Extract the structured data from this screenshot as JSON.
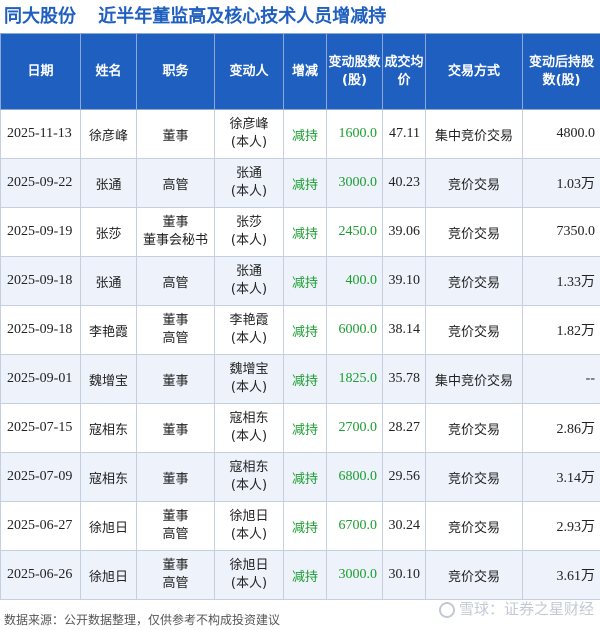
{
  "title": {
    "company": "同大股份",
    "subject": "近半年董监高及核心技术人员增减持"
  },
  "columns": [
    "日期",
    "姓名",
    "职务",
    "变动人",
    "增减",
    "变动股数(股)",
    "成交均价",
    "交易方式",
    "变动后持股数(股)"
  ],
  "header_lines": {
    "date": "日期",
    "name": "姓名",
    "role": "职务",
    "actor": "变动人",
    "dir": "增减",
    "shares_1": "变动股数",
    "shares_2": "(股)",
    "price_1": "成交",
    "price_2": "均价",
    "method": "交易方式",
    "after_1": "变动后",
    "after_2": "持股数",
    "after_3": "(股)"
  },
  "rows": [
    {
      "date": "2025-11-13",
      "name": "徐彦峰",
      "role1": "董事",
      "role2": "",
      "actor1": "徐彦峰",
      "actor2": "(本人)",
      "dir": "减持",
      "shares": "1600.0",
      "price": "47.11",
      "method": "集中竞价交易",
      "after": "4800.0"
    },
    {
      "date": "2025-09-22",
      "name": "张通",
      "role1": "高管",
      "role2": "",
      "actor1": "张通",
      "actor2": "(本人)",
      "dir": "减持",
      "shares": "3000.0",
      "price": "40.23",
      "method": "竞价交易",
      "after": "1.03万"
    },
    {
      "date": "2025-09-19",
      "name": "张莎",
      "role1": "董事",
      "role2": "董事会秘书",
      "actor1": "张莎",
      "actor2": "(本人)",
      "dir": "减持",
      "shares": "2450.0",
      "price": "39.06",
      "method": "竞价交易",
      "after": "7350.0"
    },
    {
      "date": "2025-09-18",
      "name": "张通",
      "role1": "高管",
      "role2": "",
      "actor1": "张通",
      "actor2": "(本人)",
      "dir": "减持",
      "shares": "400.0",
      "price": "39.10",
      "method": "竞价交易",
      "after": "1.33万"
    },
    {
      "date": "2025-09-18",
      "name": "李艳霞",
      "role1": "董事",
      "role2": "高管",
      "actor1": "李艳霞",
      "actor2": "(本人)",
      "dir": "减持",
      "shares": "6000.0",
      "price": "38.14",
      "method": "竞价交易",
      "after": "1.82万"
    },
    {
      "date": "2025-09-01",
      "name": "魏增宝",
      "role1": "董事",
      "role2": "",
      "actor1": "魏增宝",
      "actor2": "(本人)",
      "dir": "减持",
      "shares": "1825.0",
      "price": "35.78",
      "method": "集中竞价交易",
      "after": "--"
    },
    {
      "date": "2025-07-15",
      "name": "寇相东",
      "role1": "董事",
      "role2": "",
      "actor1": "寇相东",
      "actor2": "(本人)",
      "dir": "减持",
      "shares": "2700.0",
      "price": "28.27",
      "method": "竞价交易",
      "after": "2.86万"
    },
    {
      "date": "2025-07-09",
      "name": "寇相东",
      "role1": "董事",
      "role2": "",
      "actor1": "寇相东",
      "actor2": "(本人)",
      "dir": "减持",
      "shares": "6800.0",
      "price": "29.56",
      "method": "竞价交易",
      "after": "3.14万"
    },
    {
      "date": "2025-06-27",
      "name": "徐旭日",
      "role1": "董事",
      "role2": "高管",
      "actor1": "徐旭日",
      "actor2": "(本人)",
      "dir": "减持",
      "shares": "6700.0",
      "price": "30.24",
      "method": "竞价交易",
      "after": "2.93万"
    },
    {
      "date": "2025-06-26",
      "name": "徐旭日",
      "role1": "董事",
      "role2": "高管",
      "actor1": "徐旭日",
      "actor2": "(本人)",
      "dir": "减持",
      "shares": "3000.0",
      "price": "30.10",
      "method": "竞价交易",
      "after": "3.61万"
    }
  ],
  "footer": "数据来源：公开数据整理，仅供参考不构成投资建议",
  "brand": "雪球：证券之星财经",
  "colors": {
    "header_bg": "#1f5fbf",
    "title": "#1f5fbf",
    "change_text": "#1a9e2f",
    "row_alt": "#eef2fa"
  }
}
